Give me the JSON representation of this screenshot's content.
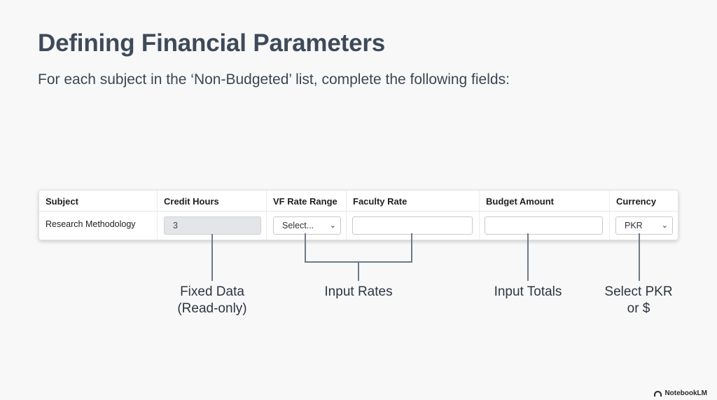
{
  "slide": {
    "title": "Defining Financial Parameters",
    "subtitle": "For each subject in the ‘Non-Budgeted’ list, complete the following fields:"
  },
  "form": {
    "headers": [
      "Subject",
      "Credit Hours",
      "VF Rate Range",
      "Faculty Rate",
      "Budget Amount",
      "Currency"
    ],
    "row": {
      "subject": "Research Methodology",
      "credit_hours": "3",
      "vf_rate_range": "Select...",
      "faculty_rate": "",
      "budget_amount": "",
      "currency": "PKR"
    }
  },
  "annotations": {
    "fixed_line1": "Fixed Data",
    "fixed_line2": "(Read-only)",
    "rates": "Input Rates",
    "totals": "Input Totals",
    "select_line1": "Select PKR",
    "select_line2": "or $"
  },
  "branding": {
    "label": "NotebookLM"
  },
  "icons": {
    "dropdown": "chevron-down-icon",
    "brand": "notebooklm-logo-icon"
  },
  "colors": {
    "title": "#3e4a5a",
    "connector": "#6b7a89",
    "readonly_fill": "#e4e5e8"
  }
}
